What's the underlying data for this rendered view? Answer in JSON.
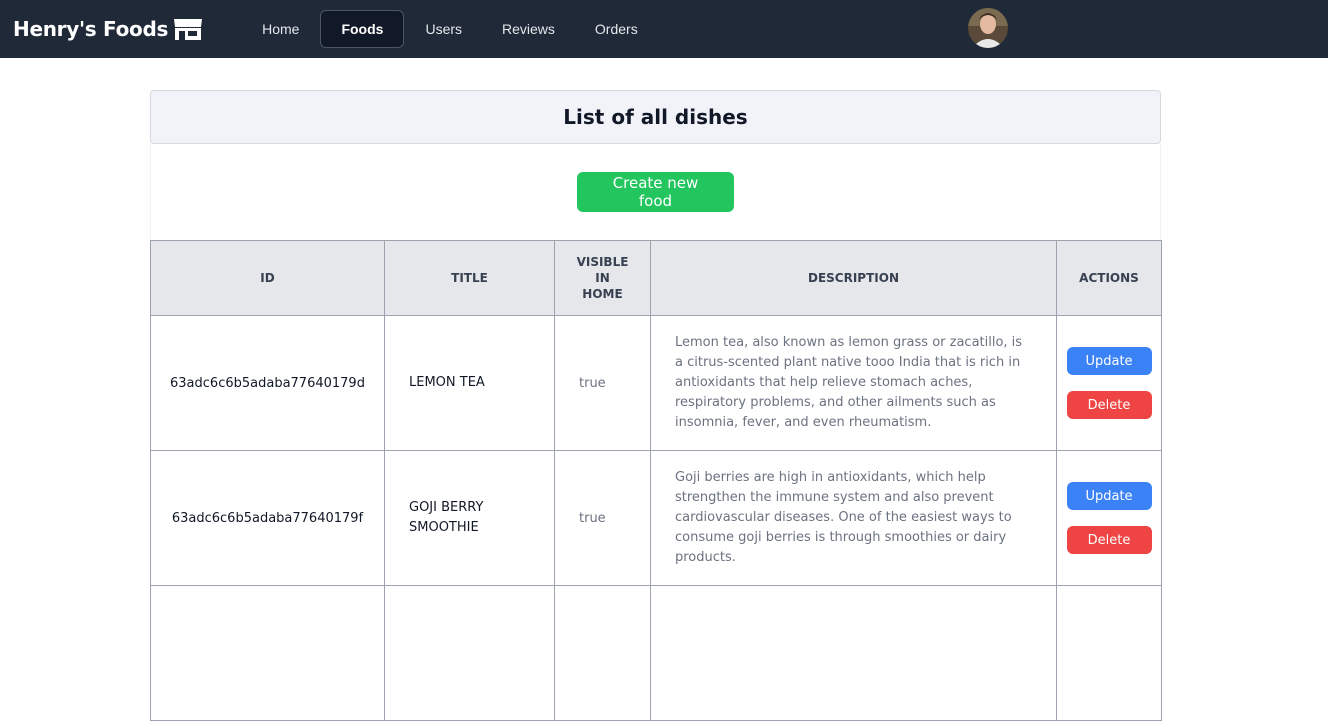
{
  "navbar": {
    "brand": "Henry's Foods",
    "links": [
      "Home",
      "Foods",
      "Users",
      "Reviews",
      "Orders"
    ],
    "active": "Foods"
  },
  "card": {
    "title": "List of all dishes",
    "create_button": "Create new food"
  },
  "table": {
    "headers": {
      "id": "ID",
      "title": "TITLE",
      "visible": [
        "VISIBLE",
        "IN",
        "HOME"
      ],
      "description": "DESCRIPTION",
      "actions": "ACTIONS"
    },
    "rows": [
      {
        "id": "63adc6c6b5adaba77640179d",
        "title": "LEMON TEA",
        "visible": "true",
        "description": "Lemon tea, also known as lemon grass or zacatillo, is a citrus-scented plant native tooo India that is rich in antioxidants that help relieve stomach aches, respiratory problems, and other ailments such as insomnia, fever, and even rheumatism.",
        "update": "Update",
        "delete": "Delete"
      },
      {
        "id": "63adc6c6b5adaba77640179f",
        "title": "GOJI BERRY SMOOTHIE",
        "visible": "true",
        "description": "Goji berries are high in antioxidants, which help strengthen the immune system and also prevent cardiovascular diseases. One of the easiest ways to consume goji berries is through smoothies or dairy products.",
        "update": "Update",
        "delete": "Delete"
      }
    ]
  },
  "colors": {
    "navbar": "#1f2937",
    "create": "#22c55e",
    "update": "#3b82f6",
    "delete": "#ef4444"
  },
  "icons": {
    "brand": "store-icon",
    "avatar": "user-avatar"
  }
}
